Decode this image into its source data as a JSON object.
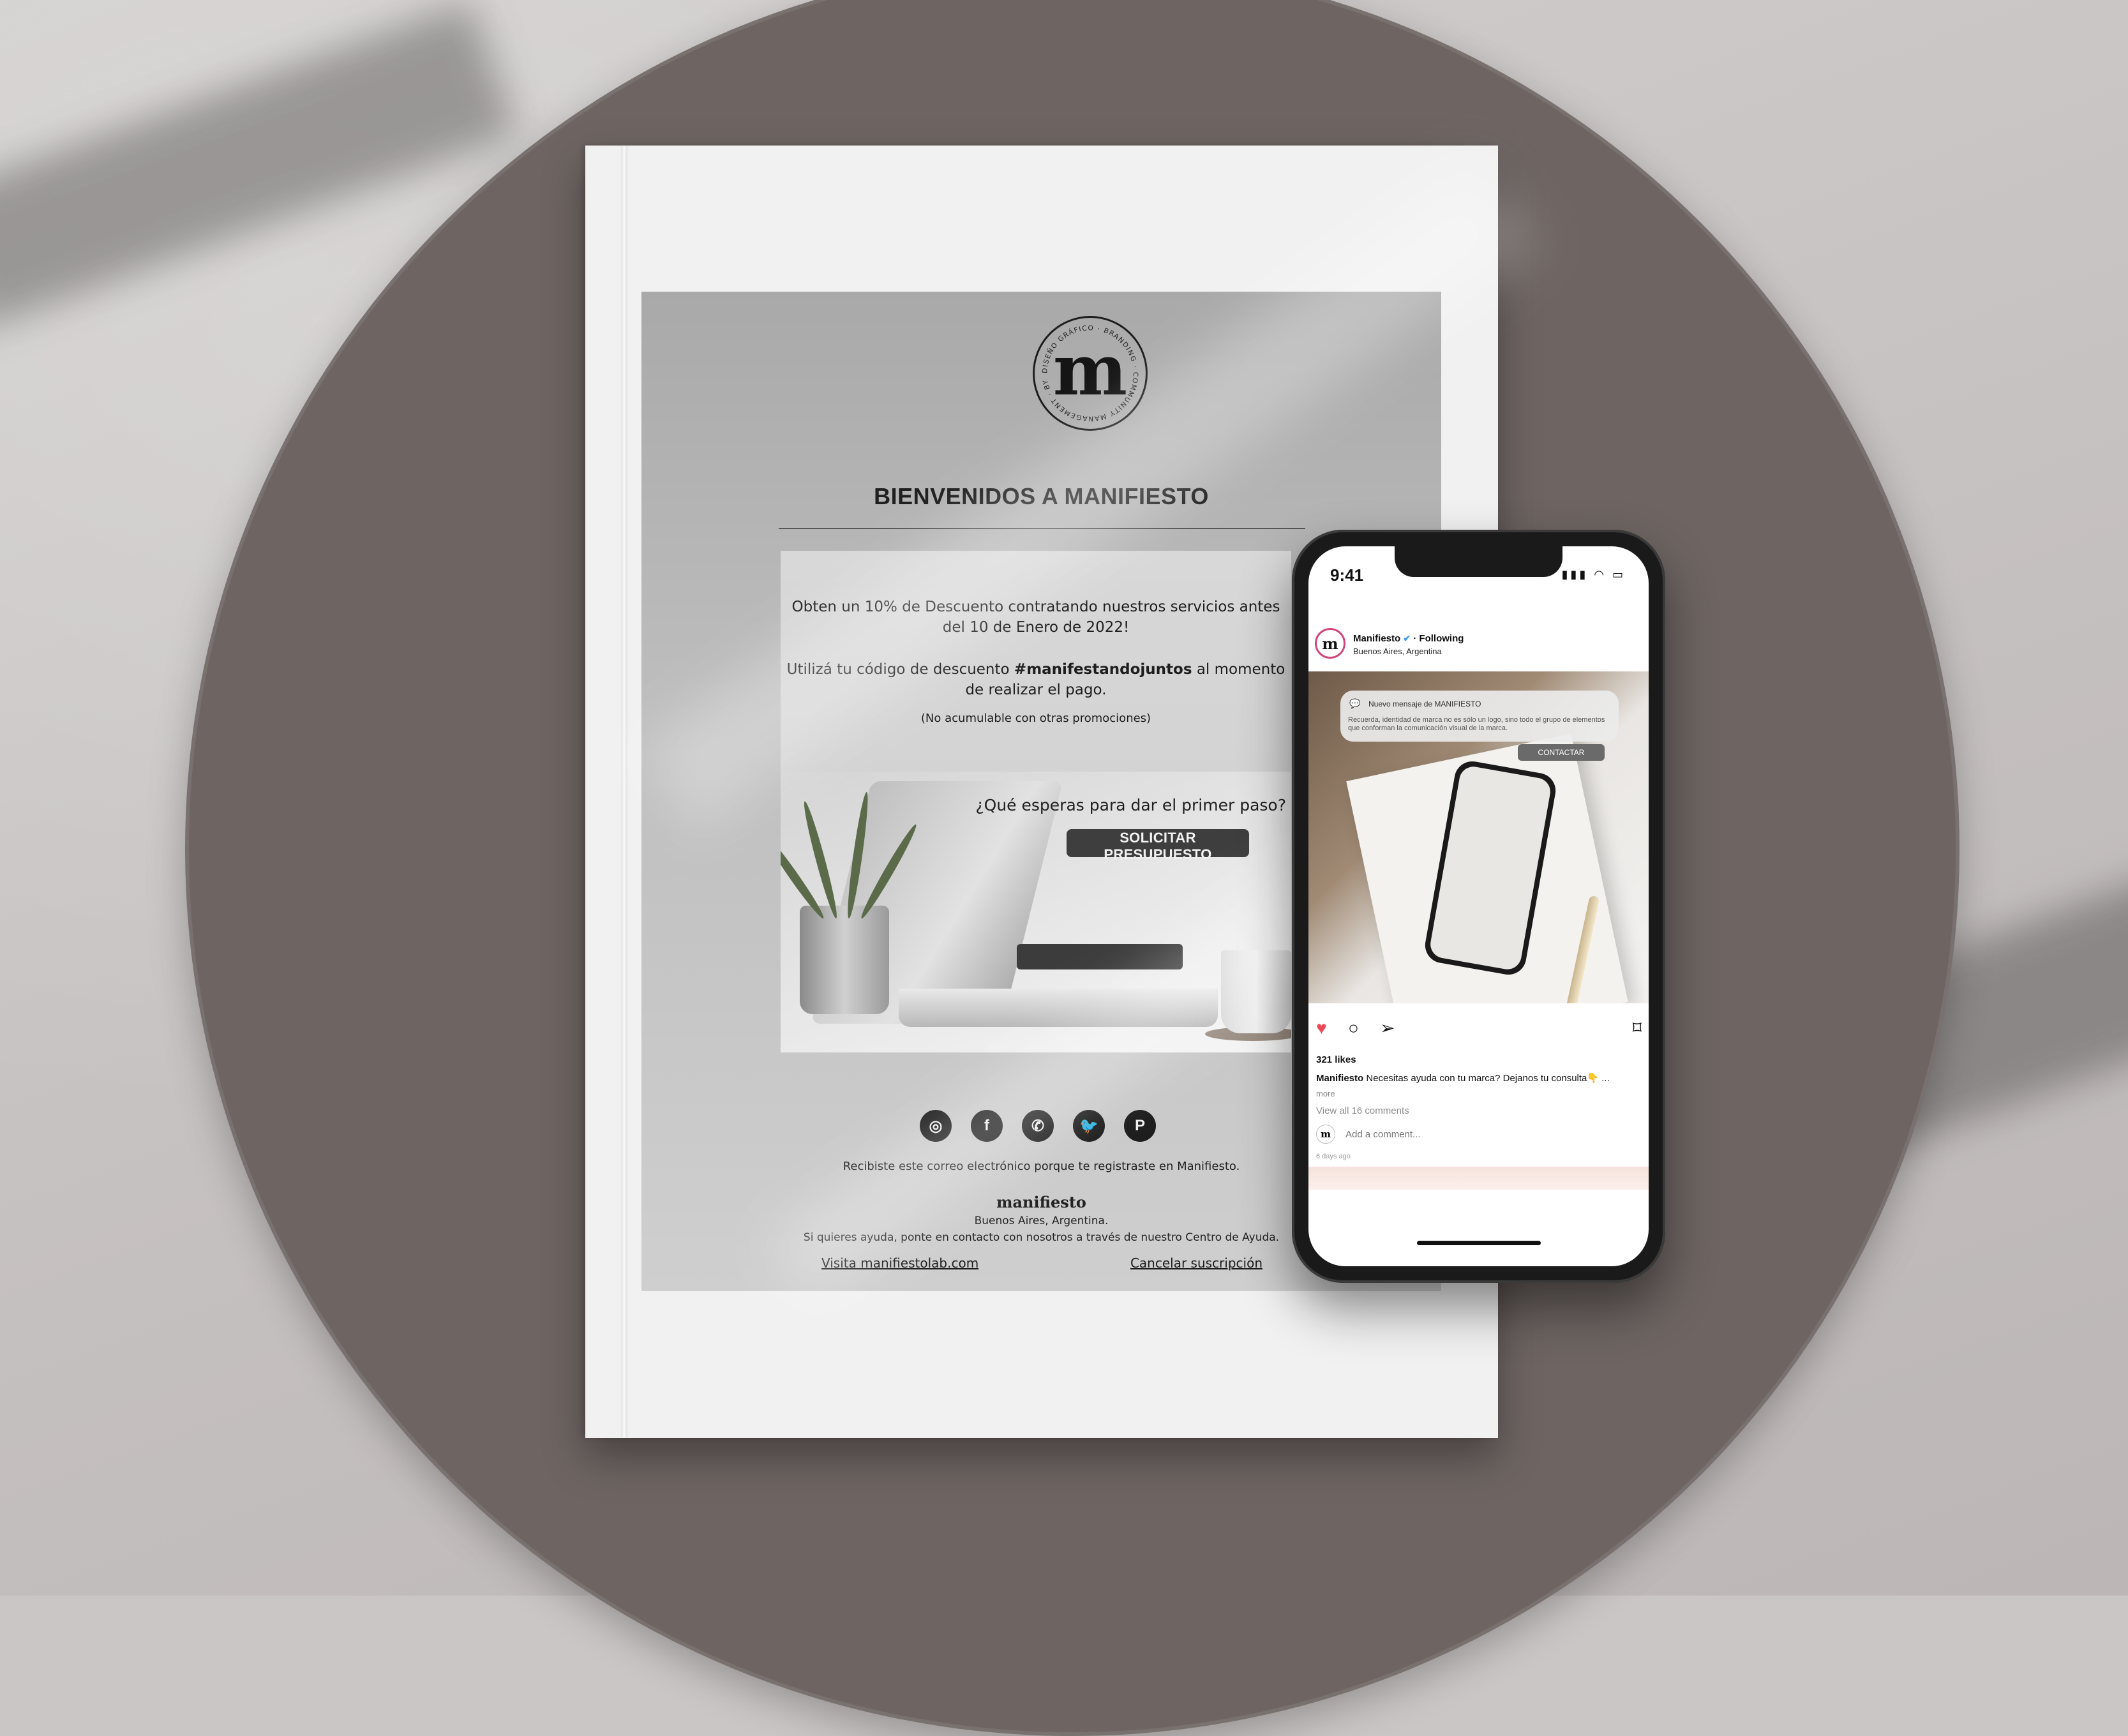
{
  "email": {
    "title": "BIENVENIDOS A MANIFIESTO",
    "logo_letter": "m",
    "logo_ring_text": "DISEÑO GRÁFICO · BRANDING · COMMUNITY MANAGEMENT · BY NATALIA MARTINEZ ·",
    "promo_line1": "Obten un 10% de Descuento contratando nuestros servicios antes",
    "promo_line1b": "del 10 de Enero de 2022!",
    "promo_line2a": "Utilizá tu código de descuento",
    "promo_code": "#manifestandojuntos",
    "promo_line2b": "al momento",
    "promo_line2c": "de realizar el pago.",
    "promo_note": "(No acumulable con otras promociones)",
    "hero_question": "¿Qué esperas para dar el primer paso?",
    "cta_label": "SOLICITAR PRESUPUESTO",
    "social_icons": [
      "instagram-icon",
      "facebook-icon",
      "whatsapp-icon",
      "twitter-icon",
      "pinterest-icon"
    ],
    "footer_reason": "Recibiste este correo electrónico porque te registraste en Manifiesto.",
    "footer_brand": "manifiesto",
    "footer_location": "Buenos Aires, Argentina.",
    "footer_help": "Si quieres ayuda, ponte en contacto con nosotros a través de nuestro Centro de Ayuda.",
    "visit_link": "Visita manifiestolab.com",
    "cancel_link": "Cancelar suscripción"
  },
  "phone": {
    "time": "9:41",
    "status_icons": [
      "signal-icon",
      "wifi-icon",
      "battery-icon"
    ],
    "account": "Manifiesto",
    "following": "· Following",
    "location": "Buenos Aires, Argentina",
    "avatar_letter": "m",
    "notification_title": "Nuevo mensaje de MANIFIESTO",
    "notification_body": "Recuerda, identidad de marca no es sólo un logo, sino todo el grupo de elementos que conforman la comunicación visual de la marca.",
    "contact_label": "CONTACTAR",
    "likes": "321 likes",
    "caption_user": "Manifiesto",
    "caption_text": "Necesitas ayuda con tu marca? Dejanos tu consulta👇 ...",
    "more": "more",
    "view_comments": "View all 16 comments",
    "add_comment_placeholder": "Add a comment...",
    "posted": "6 days ago"
  },
  "colors": {
    "plate": "#6e6562",
    "background": "#cbc6c6",
    "heart": "#ed4956",
    "cta": "#3e3e3e"
  }
}
